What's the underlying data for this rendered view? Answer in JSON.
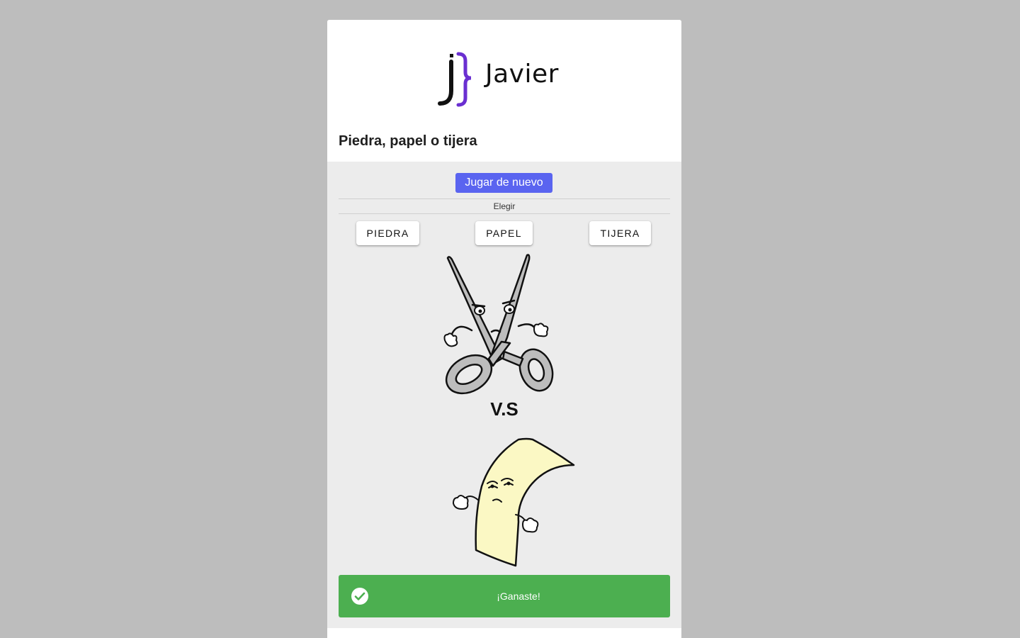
{
  "header": {
    "logo_text": "Javier",
    "title": "Piedra, papel o tijera"
  },
  "game": {
    "replay_label": "Jugar de nuevo",
    "choose_label": "Elegir",
    "choices": [
      "PIEDRA",
      "PAPEL",
      "TIJERA"
    ],
    "player_choice": "tijera",
    "cpu_choice": "papel",
    "vs_label": "V.S",
    "result_text": "¡Ganaste!"
  },
  "colors": {
    "page_background": "#bdbdbd",
    "game_background": "#ececec",
    "replay_button": "#5a64f0",
    "result_success": "#4caf50",
    "logo_accent": "#6a2fd1"
  },
  "icons": {
    "result": "check-circle-icon",
    "logo": "brace-logo-icon"
  }
}
